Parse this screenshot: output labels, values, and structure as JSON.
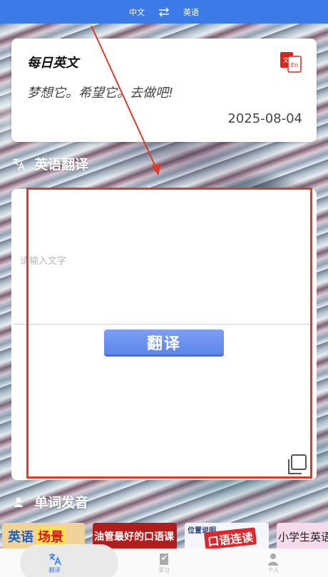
{
  "topbar": {
    "from_lang": "中文",
    "to_lang": "英语"
  },
  "daily": {
    "title": "每日英文",
    "quote": "梦想它。希望它。去做吧!",
    "date": "2025-08-04"
  },
  "translate": {
    "section_title": "英语翻译",
    "placeholder": "请输入文字",
    "button_label": "翻译"
  },
  "pronounce": {
    "section_title": "单词发音"
  },
  "banners": {
    "b1_a": "英语",
    "b1_b": "场景",
    "b2": "油管最好的口语课",
    "b3_small": "位置说明",
    "b3_tag": "口语连读",
    "b4": "小学生英语"
  },
  "nav": {
    "items": [
      "翻译",
      "学习",
      "个人"
    ]
  },
  "colors": {
    "accent": "#3a7be8",
    "annotation": "#e03a2b"
  }
}
